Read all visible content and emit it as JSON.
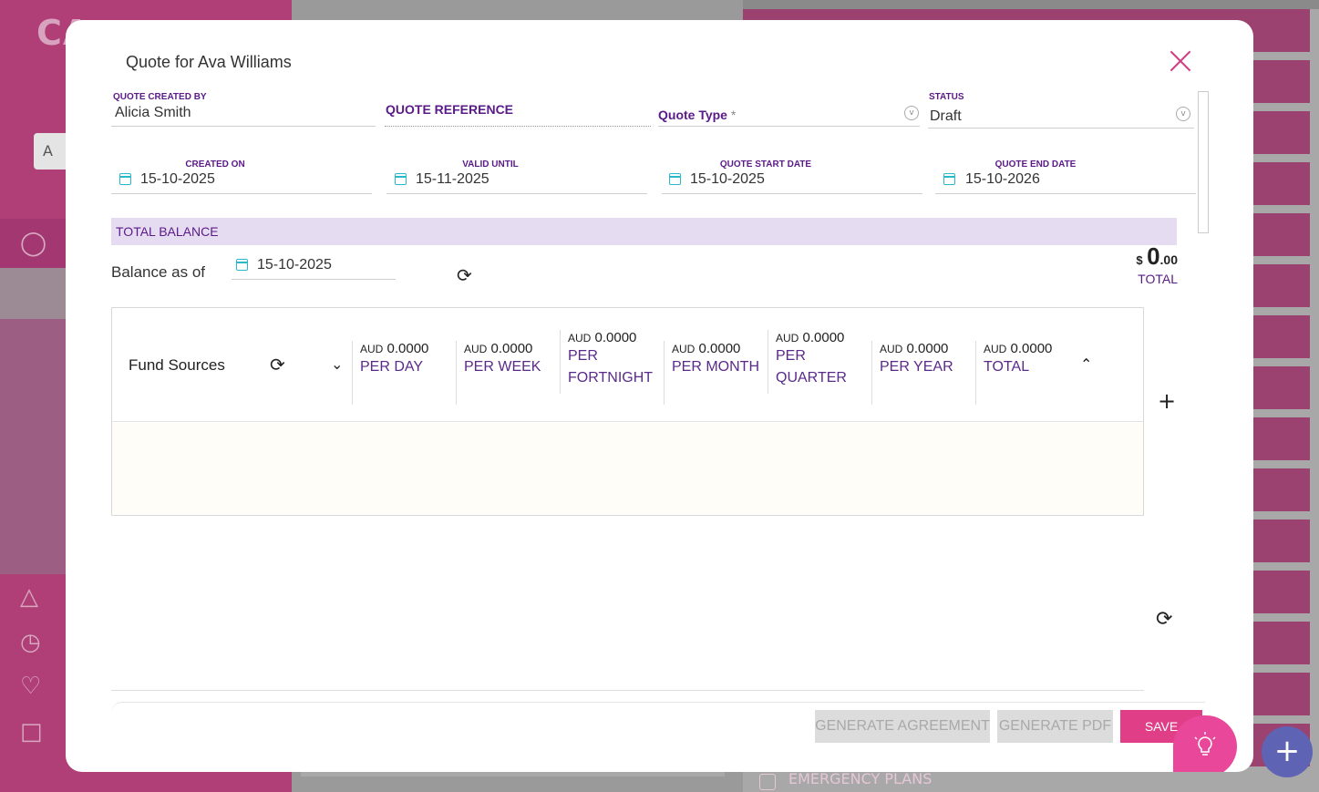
{
  "background": {
    "logo_text": "CA",
    "search_letter": "A",
    "emergency_label": "EMERGENCY PLANS"
  },
  "modal": {
    "title": "Quote for Ava Williams",
    "fields": {
      "created_by_label": "QUOTE CREATED BY",
      "created_by_value": "Alicia Smith",
      "reference_label": "QUOTE REFERENCE",
      "reference_value": "",
      "type_label": "Quote Type",
      "type_required": "*",
      "status_label": "STATUS",
      "status_value": "Draft"
    },
    "dates": {
      "created_on_label": "CREATED ON",
      "created_on_value": "15-10-2025",
      "valid_until_label": "VALID UNTIL",
      "valid_until_value": "15-11-2025",
      "start_label": "QUOTE START DATE",
      "start_value": "15-10-2025",
      "end_label": "QUOTE END DATE",
      "end_value": "15-10-2026"
    },
    "total_balance": {
      "band_label": "TOTAL BALANCE",
      "balance_as_of_label": "Balance as of",
      "balance_date": "15-10-2025",
      "currency_symbol": "$",
      "amount_int": "0",
      "amount_dec": ".00",
      "total_label": "TOTAL"
    },
    "fund_sources": {
      "title": "Fund Sources",
      "columns": [
        {
          "currency": "AUD",
          "amount": "0.0000",
          "label": "PER DAY"
        },
        {
          "currency": "AUD",
          "amount": "0.0000",
          "label": "PER WEEK"
        },
        {
          "currency": "AUD",
          "amount": "0.0000",
          "label": "PER FORTNIGHT"
        },
        {
          "currency": "AUD",
          "amount": "0.0000",
          "label": "PER MONTH"
        },
        {
          "currency": "AUD",
          "amount": "0.0000",
          "label": "PER QUARTER"
        },
        {
          "currency": "AUD",
          "amount": "0.0000",
          "label": "PER YEAR"
        },
        {
          "currency": "AUD",
          "amount": "0.0000",
          "label": "TOTAL"
        }
      ]
    },
    "buttons": {
      "generate_agreement": "GENERATE AGREEMENT",
      "generate_pdf": "GENERATE PDF",
      "save": "SAVE"
    }
  },
  "colors": {
    "accent": "#e03f88",
    "purple_label": "#5a1a88",
    "calendar_icon": "#2bb8c9",
    "band": "#e6dcf2"
  },
  "icons": [
    "close-icon",
    "calendar-icon",
    "refresh-icon",
    "chevron-down-icon",
    "chevron-up-icon",
    "plus-icon",
    "lightbulb-icon"
  ]
}
